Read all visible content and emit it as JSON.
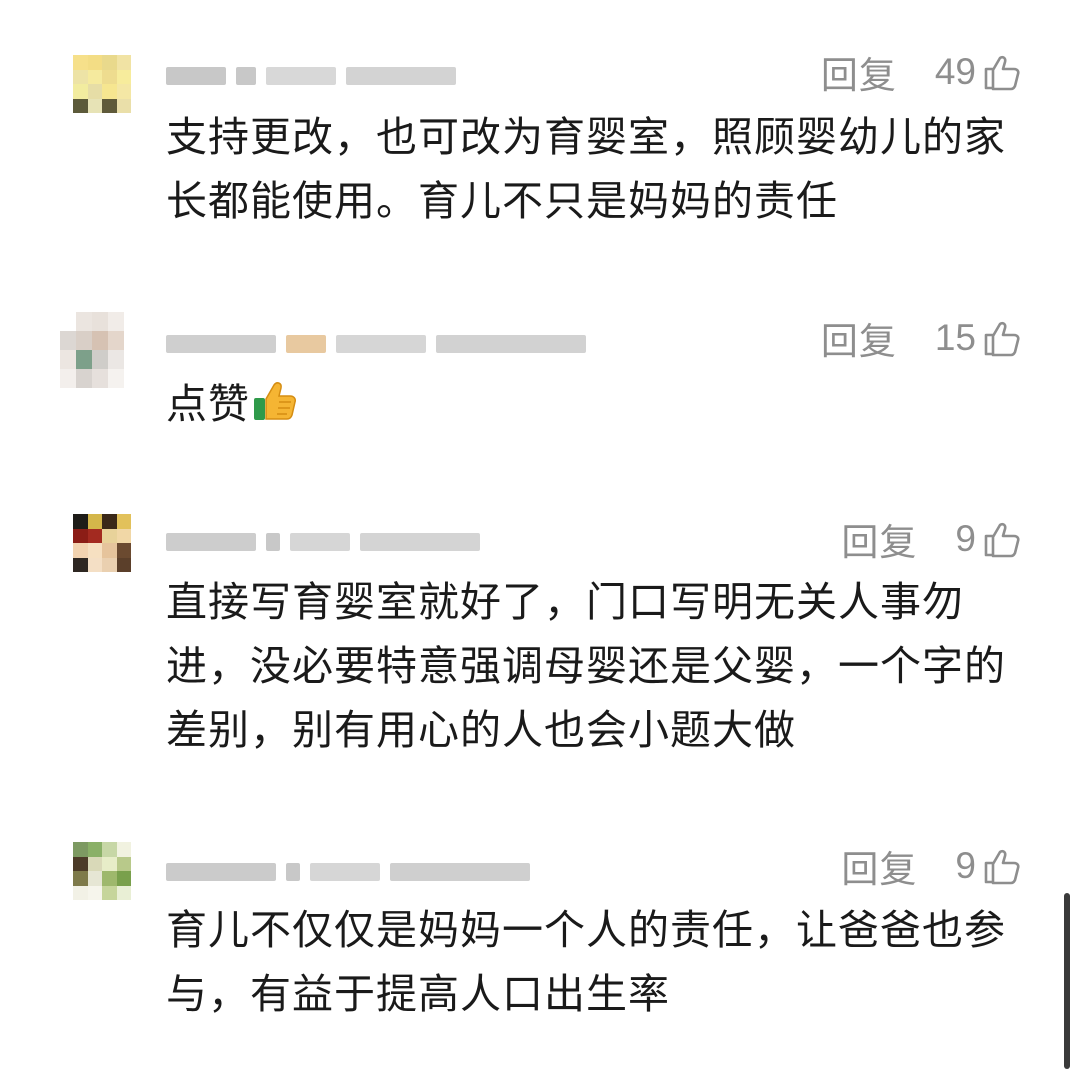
{
  "comments": [
    {
      "reply_label": "回复",
      "likes": "49",
      "text": "支持更改，也可改为育婴室，照顾婴幼儿的家长都能使用。育儿不只是妈妈的责任",
      "avatar_colors": [
        "#f6e08a",
        "#f3dd85",
        "#e9d98c",
        "#f1e3a4",
        "#ffffff",
        "#ede3a6",
        "#f5ea9e",
        "#eedc8f",
        "#f7ec9c",
        "#ffffff",
        "#f2ec9f",
        "#e6dda6",
        "#f6e690",
        "#f4e7a5",
        "#ffffff",
        "#5c5a3a",
        "#e7e3b6",
        "#5f5a3a",
        "#eadfa9",
        "#ffffff",
        "#ffffff",
        "#ffffff",
        "#ffffff",
        "#ffffff",
        "#ffffff"
      ]
    },
    {
      "reply_label": "回复",
      "likes": "15",
      "text": "点赞",
      "avatar_colors": [
        "#ffffff",
        "#ebe5e0",
        "#e8e1db",
        "#f1ece8",
        "#ffffff",
        "#dcd7d3",
        "#d9cfc7",
        "#d6c2b3",
        "#e4d6cb",
        "#ffffff",
        "#ece6e1",
        "#7da08a",
        "#cfcdc9",
        "#ebe7e4",
        "#ffffff",
        "#f3efec",
        "#d8d3cf",
        "#e6e0dc",
        "#f5f2ef",
        "#ffffff",
        "#ffffff",
        "#ffffff",
        "#ffffff",
        "#ffffff",
        "#ffffff"
      ]
    },
    {
      "reply_label": "回复",
      "likes": "9",
      "text": "直接写育婴室就好了，门口写明无关人事勿进，没必要特意强调母婴还是父婴，一个字的差别，别有用心的人也会小题大做",
      "avatar_colors": [
        "#1e1c18",
        "#d4b64a",
        "#3a2818",
        "#e2c15b",
        "#ffffff",
        "#8b1d16",
        "#a32a20",
        "#e8d29a",
        "#f1d7a6",
        "#ffffff",
        "#f2d3b0",
        "#f6e0c1",
        "#e6c49c",
        "#6b4a30",
        "#ffffff",
        "#2e2722",
        "#f4dfc5",
        "#ead0b0",
        "#5b3f2a",
        "#ffffff",
        "#ffffff",
        "#ffffff",
        "#ffffff",
        "#ffffff",
        "#ffffff"
      ]
    },
    {
      "reply_label": "回复",
      "likes": "9",
      "text": "育儿不仅仅是妈妈一个人的责任，让爸爸也参与，有益于提高人口出生率",
      "avatar_colors": [
        "#7d9a62",
        "#8ab067",
        "#c7d7a6",
        "#f1f2e0",
        "#ffffff",
        "#4c3b28",
        "#d9d9b8",
        "#e7edc8",
        "#b8c98a",
        "#ffffff",
        "#7e7a4a",
        "#e6e6d4",
        "#9eb86c",
        "#79a04c",
        "#ffffff",
        "#f2f1e6",
        "#f6f5ec",
        "#c6d59b",
        "#e9efd5",
        "#ffffff",
        "#ffffff",
        "#ffffff",
        "#ffffff",
        "#ffffff",
        "#ffffff"
      ]
    }
  ]
}
